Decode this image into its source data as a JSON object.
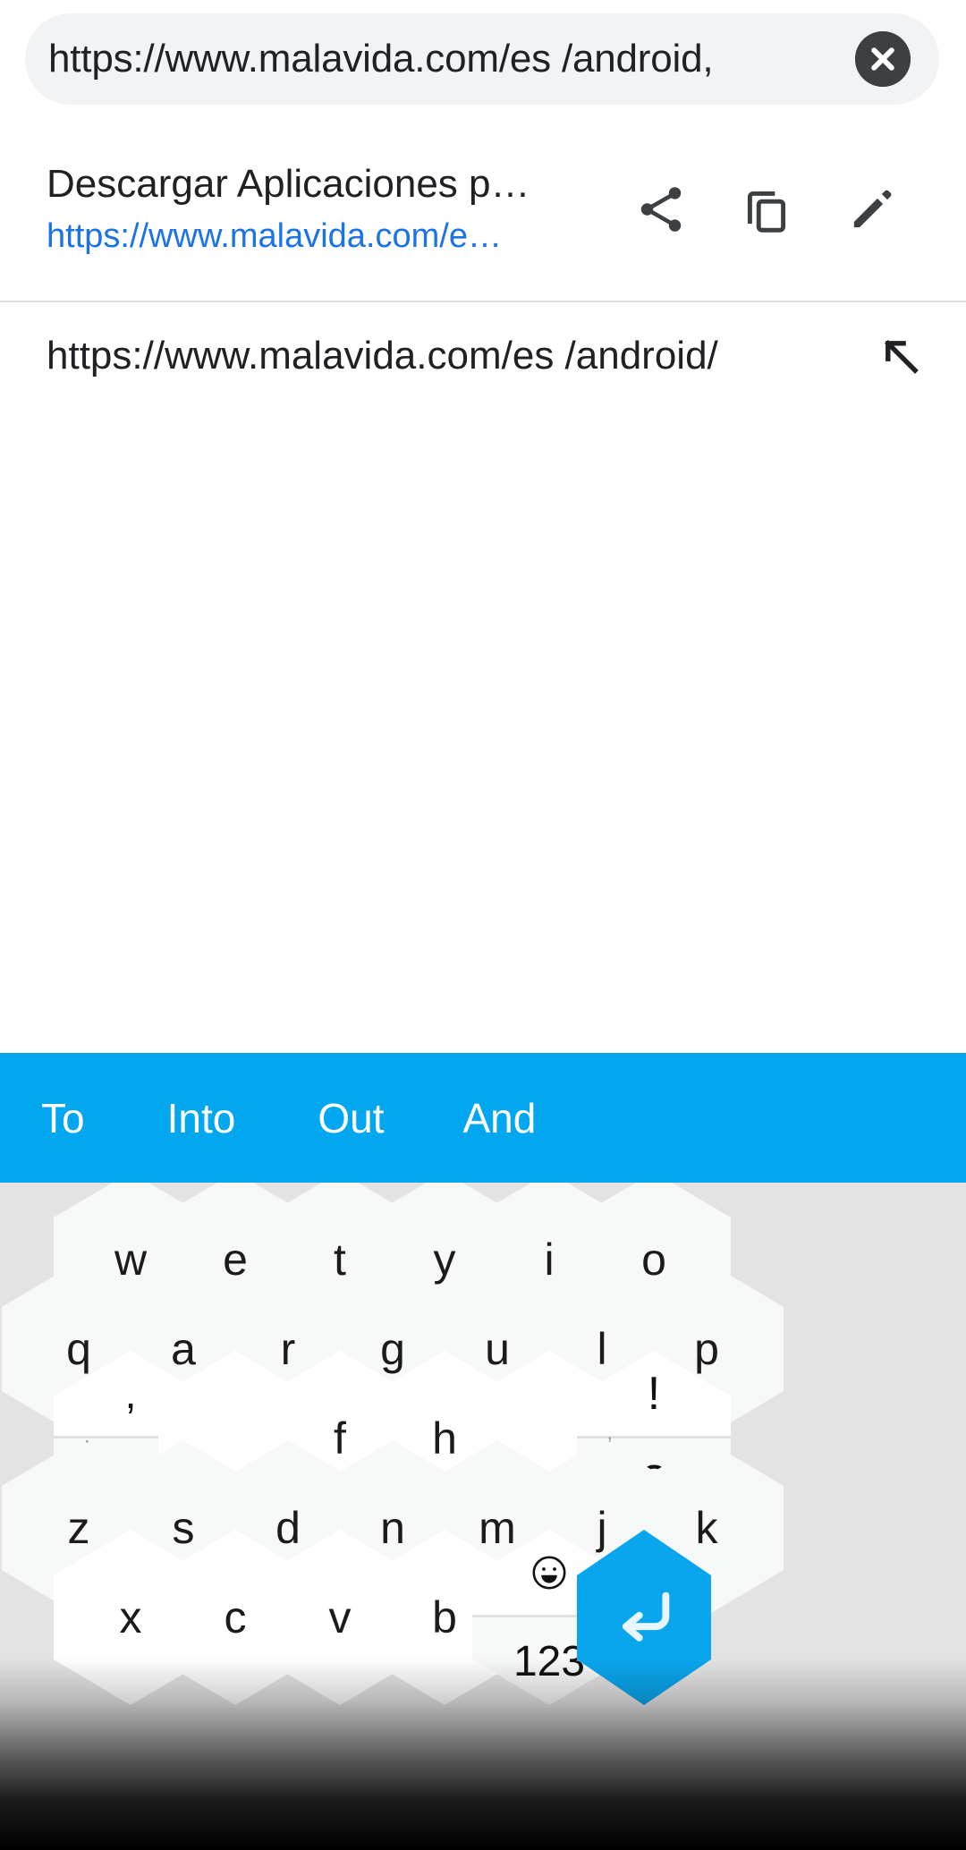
{
  "omnibox": {
    "value": "https://www.malavida.com/es  /android/",
    "display_value": "https://www.malavida.com/es  /android,",
    "clear_icon": "close-circle-icon"
  },
  "suggestions": [
    {
      "title": "Descargar Aplicaciones p…",
      "url": "https://www.malavida.com/e…",
      "actions": [
        {
          "name": "share-icon",
          "label": "Share"
        },
        {
          "name": "copy-icon",
          "label": "Copy"
        },
        {
          "name": "edit-icon",
          "label": "Edit"
        }
      ]
    },
    {
      "url": "https://www.malavida.com/es /android/",
      "action": {
        "name": "fill-query-arrow-icon",
        "label": "Fill query"
      }
    }
  ],
  "keyboard": {
    "accent_color": "#0aa6ed",
    "suggestion_bar_color": "#02a7f0",
    "background_color": "#e3e3e3",
    "key_color": "#f7f8f8",
    "word_suggestions": [
      "To",
      "Into",
      "Out",
      "And"
    ],
    "rows": [
      {
        "keys": [
          "w",
          "e",
          "t",
          "y",
          "i",
          "o"
        ]
      },
      {
        "keys": [
          "q",
          "a",
          "r",
          "g",
          "u",
          "l",
          "p"
        ]
      },
      {
        "keys": [
          "f",
          "h"
        ]
      },
      {
        "keys": [
          "z",
          "s",
          "d",
          "n",
          "m",
          "j",
          "k"
        ]
      },
      {
        "keys": [
          "x",
          "c",
          "v",
          "b"
        ]
      }
    ],
    "punct_left": {
      "top_main": ",",
      "top_sup": ";",
      "bottom_main": ".",
      "bottom_sup": ":"
    },
    "punct_right": {
      "top_main": "!",
      "top_sup": "\"",
      "bottom_main": "?",
      "bottom_sup": "’"
    },
    "mode_key": {
      "top": "😀",
      "top_name": "emoji-icon",
      "bottom": "123",
      "bottom_name": "numeric-mode-label"
    },
    "enter_key": {
      "name": "enter-key",
      "icon": "enter-arrow-icon"
    }
  }
}
